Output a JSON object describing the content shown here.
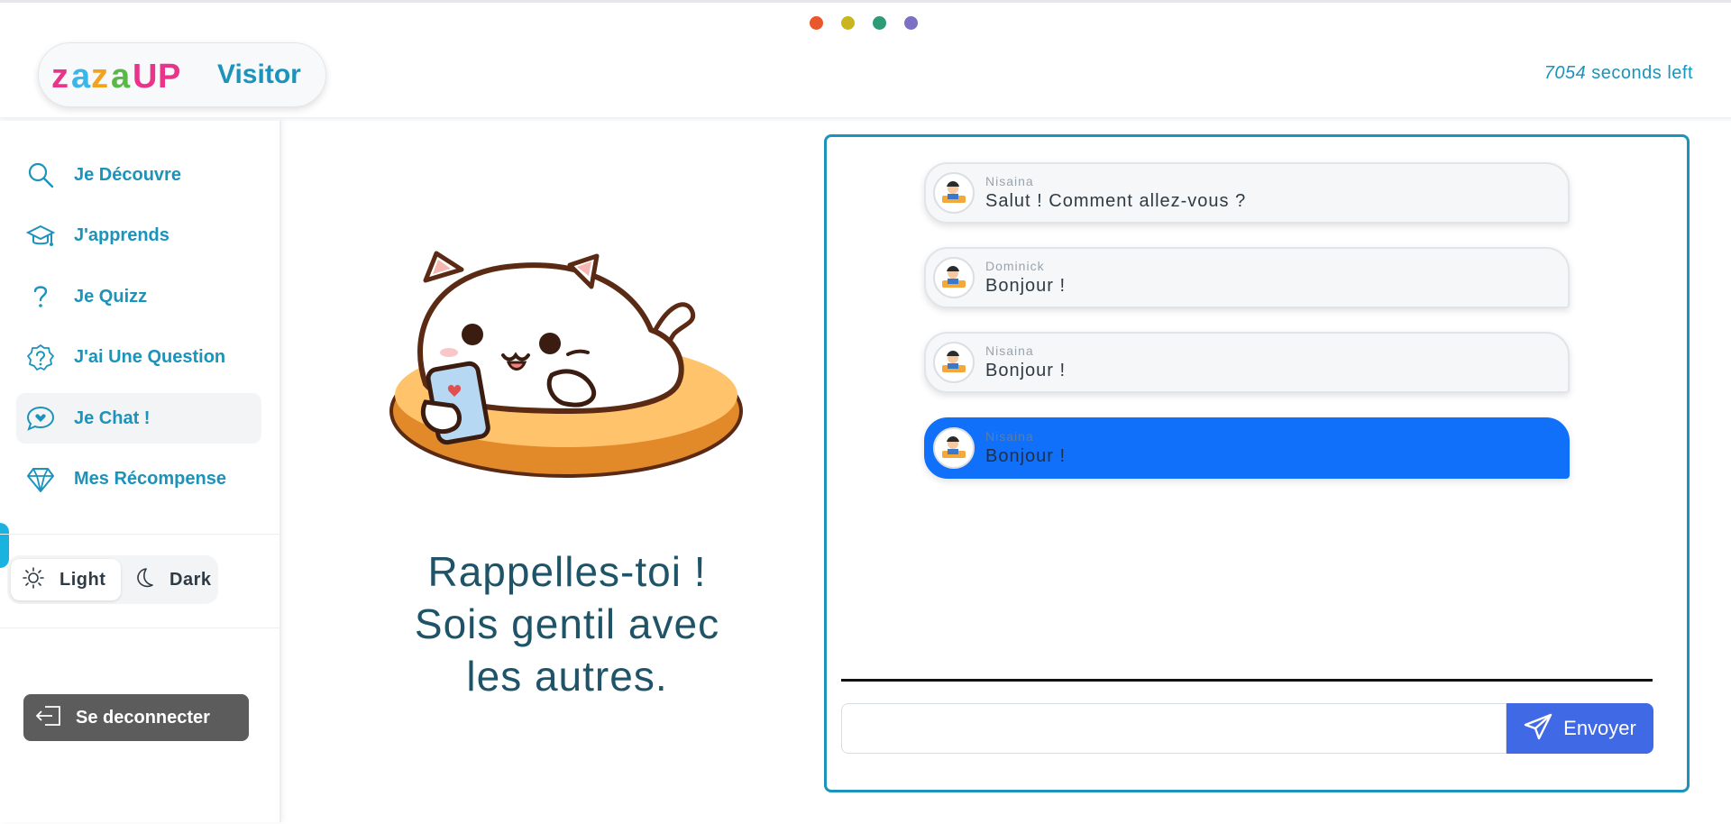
{
  "header": {
    "logo_text": "zazaUP",
    "user_role": "Visitor",
    "timer_value": "7054",
    "timer_suffix": "seconds left",
    "window_dots": [
      "#e9572d",
      "#c9b51f",
      "#2e9b78",
      "#7b70c4"
    ]
  },
  "sidebar": {
    "items": [
      {
        "label": "Je Découvre",
        "icon": "search-icon"
      },
      {
        "label": "J'apprends",
        "icon": "graduation-cap-icon"
      },
      {
        "label": "Je Quizz",
        "icon": "question-mark-icon"
      },
      {
        "label": "J'ai Une Question",
        "icon": "question-badge-icon"
      },
      {
        "label": "Je Chat !",
        "icon": "chat-heart-icon",
        "active": true
      },
      {
        "label": "Mes Récompense",
        "icon": "diamond-icon"
      }
    ],
    "theme": {
      "light_label": "Light",
      "dark_label": "Dark",
      "selected": "Light"
    },
    "logout_label": "Se deconnecter"
  },
  "main": {
    "reminder_lines": [
      "Rappelles-toi !",
      "Sois gentil avec",
      "les autres."
    ]
  },
  "chat": {
    "messages": [
      {
        "author": "Nisaina",
        "text": "Salut ! Comment allez-vous ?"
      },
      {
        "author": "Dominick",
        "text": "Bonjour !"
      },
      {
        "author": "Nisaina",
        "text": "Bonjour !"
      },
      {
        "author": "Nisaina",
        "text": "Bonjour !",
        "highlighted": true
      }
    ],
    "input_value": "",
    "send_label": "Envoyer"
  },
  "colors": {
    "accent": "#1b93bb",
    "highlight_message": "#1170fa",
    "send_button": "#4069e6",
    "logout_button": "#5c5c5c"
  }
}
